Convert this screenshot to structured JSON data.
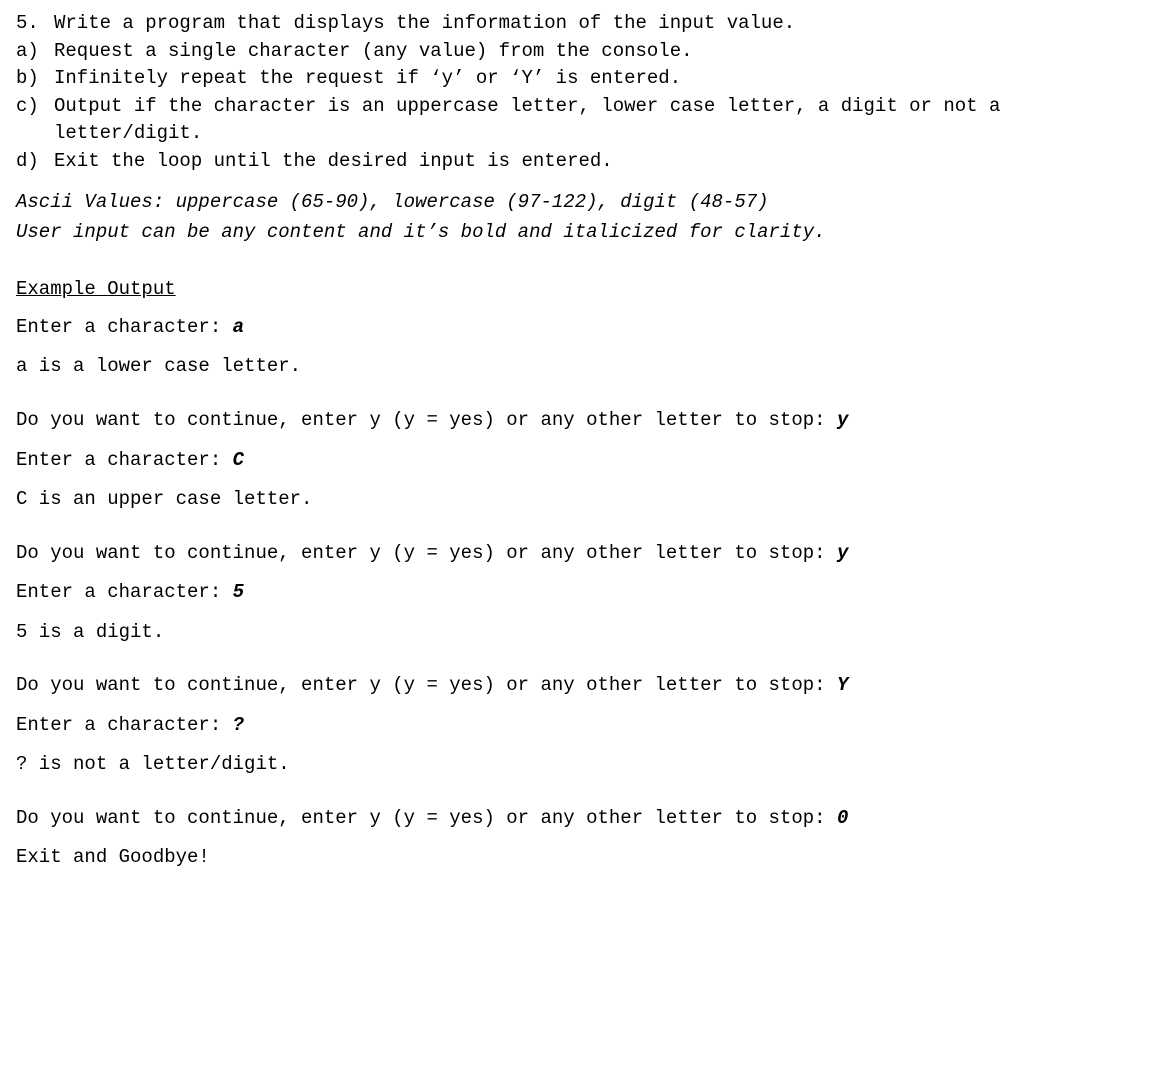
{
  "prompt": {
    "num": "5.",
    "title": "Write a program that displays the information of the input value.",
    "items": [
      {
        "marker": "a)",
        "text": "Request a single character (any value) from the console."
      },
      {
        "marker": "b)",
        "text": "Infinitely repeat the request if ‘y’ or ‘Y’ is entered."
      },
      {
        "marker": "c)",
        "text": "Output if the character is an uppercase letter, lower case letter, a digit or not a letter/digit."
      },
      {
        "marker": "d)",
        "text": "Exit the loop until the desired input is entered."
      }
    ],
    "hint1": "Ascii Values: uppercase (65-90), lowercase (97-122), digit (48-57)",
    "hint2": "User input can be any content and it’s bold and italicized for clarity."
  },
  "example": {
    "heading": "Example Output",
    "runs": [
      {
        "enter_prompt": "Enter a character: ",
        "enter_value": "a",
        "result": "a is a lower case letter.",
        "cont_prompt": "Do you want to continue, enter y (y = yes) or any other letter to stop: ",
        "cont_value": "y"
      },
      {
        "enter_prompt": "Enter a character: ",
        "enter_value": "C",
        "result": "C is an upper case letter.",
        "cont_prompt": "Do you want to continue, enter y (y = yes) or any other letter to stop: ",
        "cont_value": "y"
      },
      {
        "enter_prompt": "Enter a character: ",
        "enter_value": "5",
        "result": "5 is a digit.",
        "cont_prompt": "Do you want to continue, enter y (y = yes) or any other letter to stop: ",
        "cont_value": "Y"
      },
      {
        "enter_prompt": "Enter a character: ",
        "enter_value": "?",
        "result": "? is not a letter/digit.",
        "cont_prompt": "Do you want to continue, enter y (y = yes) or any other letter to stop: ",
        "cont_value": "0"
      }
    ],
    "exit": "Exit and Goodbye!"
  }
}
